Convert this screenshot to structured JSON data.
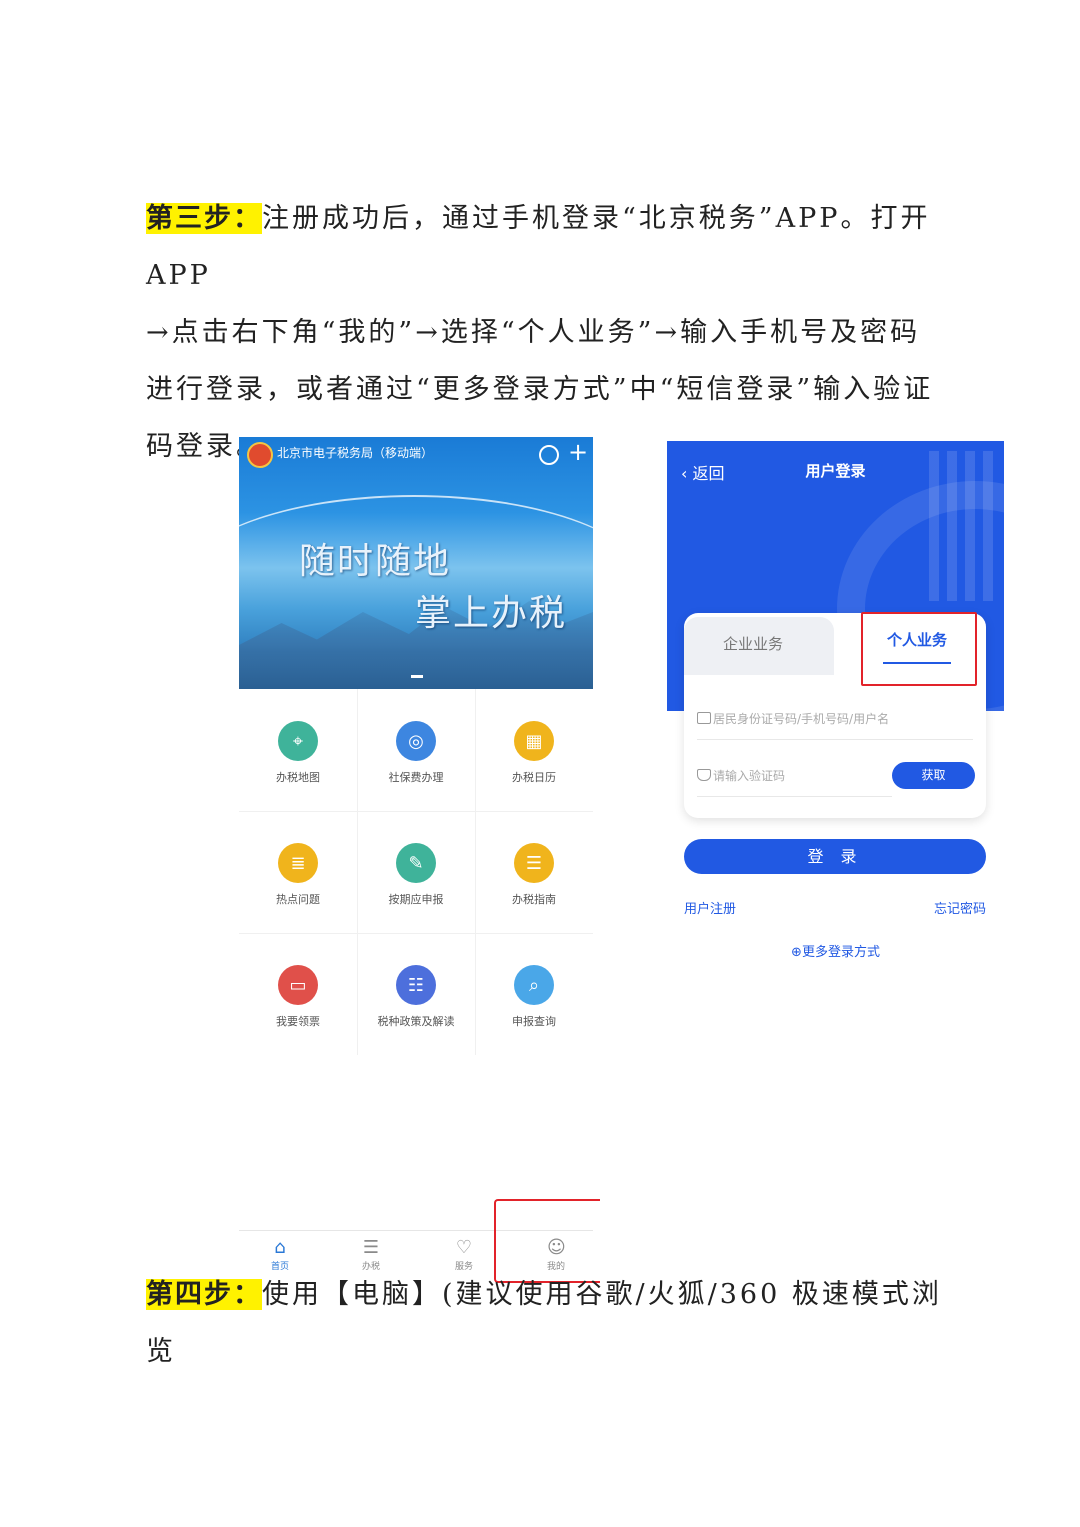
{
  "step3": {
    "label": "第三步：",
    "text_line1": "注册成功后，通过手机登录“北京税务”APP。打开 APP",
    "text_line2": "→点击右下角“我的”→选择“个人业务”→输入手机号及密码",
    "text_line3": "进行登录，或者通过“更多登录方式”中“短信登录”输入验证",
    "text_line4": "码登录。"
  },
  "phone1": {
    "header_title": "北京市电子税务局（移动端）",
    "banner_line1": "随时随地",
    "banner_line2": "掌上办税",
    "grid": [
      {
        "label": "办税地图",
        "icon": "map-icon",
        "color": "#3fb39a",
        "glyph": "⌖"
      },
      {
        "label": "社保费办理",
        "icon": "social-security-icon",
        "color": "#3d86e0",
        "glyph": "◎"
      },
      {
        "label": "办税日历",
        "icon": "calendar-icon",
        "color": "#f0b41c",
        "glyph": "▦"
      },
      {
        "label": "热点问题",
        "icon": "hot-question-icon",
        "color": "#f0b41c",
        "glyph": "≣"
      },
      {
        "label": "按期应申报",
        "icon": "declare-icon",
        "color": "#3fb39a",
        "glyph": "✎"
      },
      {
        "label": "办税指南",
        "icon": "guide-icon",
        "color": "#f0b41c",
        "glyph": "☰"
      },
      {
        "label": "我要领票",
        "icon": "ticket-icon",
        "color": "#e0504a",
        "glyph": "▭"
      },
      {
        "label": "税种政策及解读",
        "icon": "policy-icon",
        "color": "#4d6fdc",
        "glyph": "☷"
      },
      {
        "label": "申报查询",
        "icon": "query-icon",
        "color": "#4aa7e8",
        "glyph": "⌕"
      }
    ],
    "tabs": [
      {
        "label": "首页",
        "icon": "home-icon",
        "glyph": "⌂"
      },
      {
        "label": "办税",
        "icon": "list-icon",
        "glyph": "☰"
      },
      {
        "label": "服务",
        "icon": "heart-icon",
        "glyph": "♡"
      },
      {
        "label": "我的",
        "icon": "user-icon",
        "glyph": "☺"
      }
    ]
  },
  "phone2": {
    "back_label": "返回",
    "title": "用户登录",
    "tab_enterprise": "企业业务",
    "tab_personal": "个人业务",
    "id_placeholder": "居民身份证号码/手机号码/用户名",
    "code_placeholder": "请输入验证码",
    "get_code_label": "获取",
    "login_label": "登 录",
    "register_label": "用户注册",
    "forgot_label": "忘记密码",
    "more_login_label": "⊕更多登录方式"
  },
  "step4": {
    "label": "第四步：",
    "text": "使用【电脑】(建议使用谷歌/火狐/360 极速模式浏览"
  },
  "colors": {
    "highlight": "#fff200",
    "brand_blue": "#2159e3",
    "red_box": "#e2232a"
  }
}
